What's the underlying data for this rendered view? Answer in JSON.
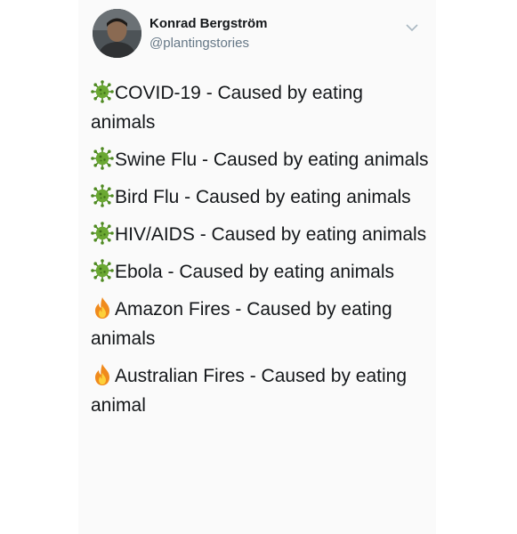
{
  "tweet": {
    "author": {
      "name": "Konrad Bergström",
      "handle": "@plantingstories"
    },
    "lines": [
      {
        "icon": "virus-icon",
        "text": "COVID-19 - Caused by eating animals"
      },
      {
        "icon": "virus-icon",
        "text": "Swine Flu - Caused by eating animals"
      },
      {
        "icon": "virus-icon",
        "text": "Bird Flu - Caused by eating animals"
      },
      {
        "icon": "virus-icon",
        "text": "HIV/AIDS - Caused by eating animals"
      },
      {
        "icon": "virus-icon",
        "text": "Ebola - Caused by eating animals"
      },
      {
        "icon": "fire-icon",
        "text": "Amazon Fires - Caused by eating animals"
      },
      {
        "icon": "fire-icon",
        "text": "Australian Fires - Caused by eating animal"
      }
    ]
  },
  "colors": {
    "text": "#14171a",
    "handle": "#657786",
    "virus": "#5f9a2c",
    "fire": "#f5a623"
  }
}
